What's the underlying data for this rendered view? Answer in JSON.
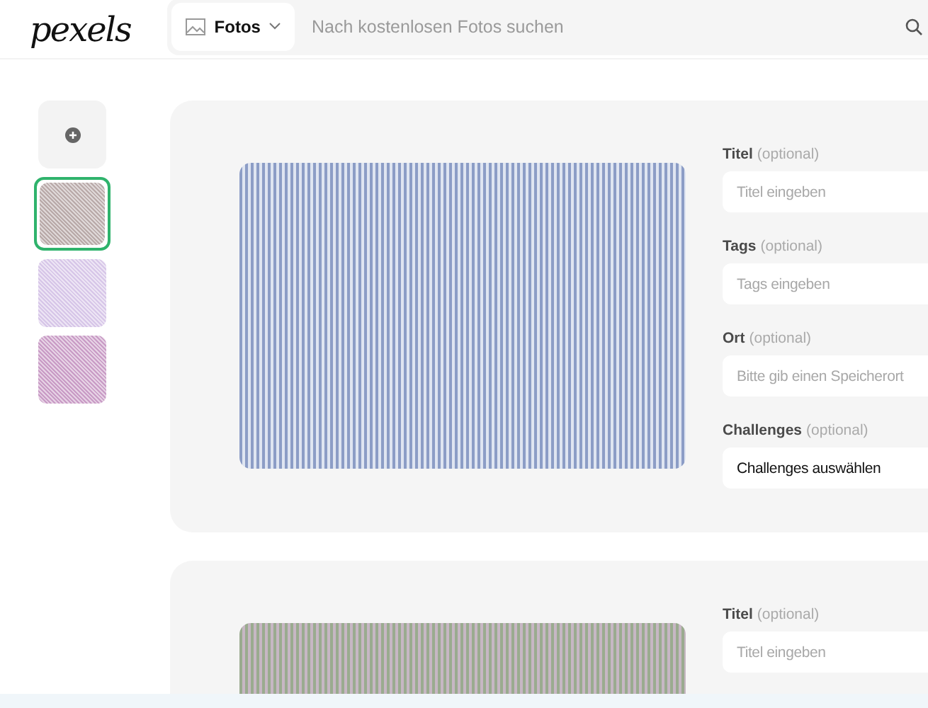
{
  "header": {
    "logo": "pexels",
    "media_type": {
      "label": "Fotos"
    },
    "search": {
      "placeholder": "Nach kostenlosen Fotos suchen"
    }
  },
  "thumbnails": [
    {
      "selected": true
    },
    {
      "selected": false
    },
    {
      "selected": false
    }
  ],
  "uploads": [
    {
      "fields": [
        {
          "kind": "input",
          "label": "Titel",
          "note": "(optional)",
          "placeholder": "Titel eingeben"
        },
        {
          "kind": "input",
          "label": "Tags",
          "note": "(optional)",
          "placeholder": "Tags eingeben"
        },
        {
          "kind": "input",
          "label": "Ort",
          "note": "(optional)",
          "placeholder": "Bitte gib einen Speicherort"
        },
        {
          "kind": "select",
          "label": "Challenges",
          "note": "(optional)",
          "value": "Challenges auswählen"
        }
      ]
    },
    {
      "fields": [
        {
          "kind": "input",
          "label": "Titel",
          "note": "(optional)",
          "placeholder": "Titel eingeben"
        }
      ]
    }
  ]
}
